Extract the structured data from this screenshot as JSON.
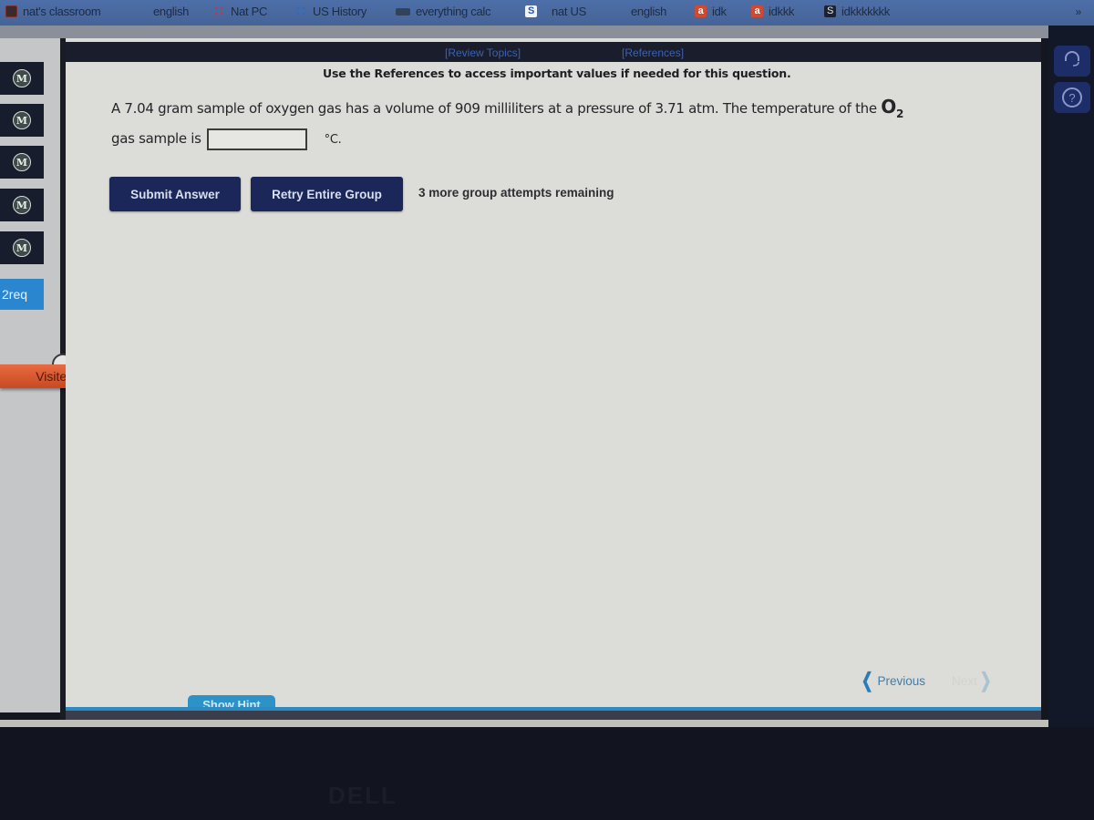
{
  "bookmarks": {
    "items": [
      {
        "label": "nat's classroom",
        "icon": "classroom-icon"
      },
      {
        "label": "english",
        "icon": ""
      },
      {
        "label": "Nat PC",
        "icon": "red-dots-icon"
      },
      {
        "label": "US History",
        "icon": "blue-dots-icon"
      },
      {
        "label": "everything calc",
        "icon": "arrow-icon"
      },
      {
        "label": "nat US",
        "icon": "s-blue-icon",
        "glyph": "S"
      },
      {
        "label": "english",
        "icon": ""
      },
      {
        "label": "idk",
        "icon": "amazon-icon",
        "glyph": "a"
      },
      {
        "label": "idkkk",
        "icon": "amazon-icon",
        "glyph": "a"
      },
      {
        "label": "idkkkkkkk",
        "icon": "s-dark-icon",
        "glyph": "S"
      }
    ],
    "more": "»"
  },
  "nav": {
    "items": [
      "M",
      "M",
      "M",
      "M",
      "M"
    ],
    "current_label": "2req",
    "visited_label": "Visited"
  },
  "right_panel": {
    "support_icon": "headset-icon",
    "help_icon": "?"
  },
  "main": {
    "review_topics": "[Review Topics]",
    "references": "[References]",
    "refs_note": "Use the References to access important values if needed for this question.",
    "question_part1": "A 7.04 gram sample of oxygen gas has a volume of 909 milliliters at a pressure of 3.71 atm. The temperature of the ",
    "formula_main": "O",
    "formula_sub": "2",
    "question_part2": "gas sample is",
    "answer_value": "",
    "unit": "°C.",
    "submit_label": "Submit Answer",
    "retry_label": "Retry Entire Group",
    "attempts_text": "3 more group attempts remaining",
    "previous_label": "Previous",
    "next_label": "Next",
    "hint_label": "Show Hint"
  },
  "bezel": {
    "brand": "DELL"
  }
}
